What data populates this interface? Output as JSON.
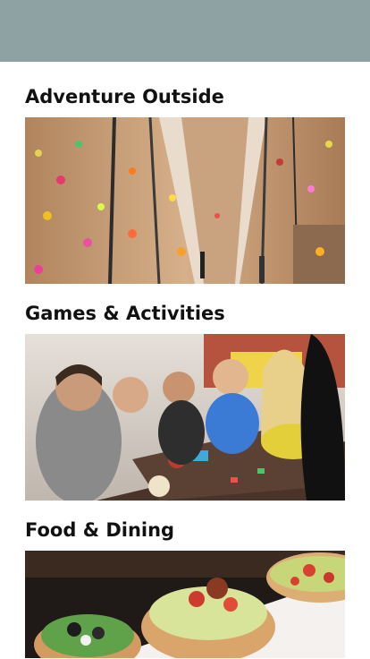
{
  "header": {
    "bar_color": "#8fa2a3"
  },
  "sections": [
    {
      "title": "Adventure Outside",
      "image_icon": "climbing-wall-photo"
    },
    {
      "title": "Games & Activities",
      "image_icon": "board-game-group-photo"
    },
    {
      "title": "Food & Dining",
      "image_icon": "tacos-plate-photo"
    }
  ]
}
